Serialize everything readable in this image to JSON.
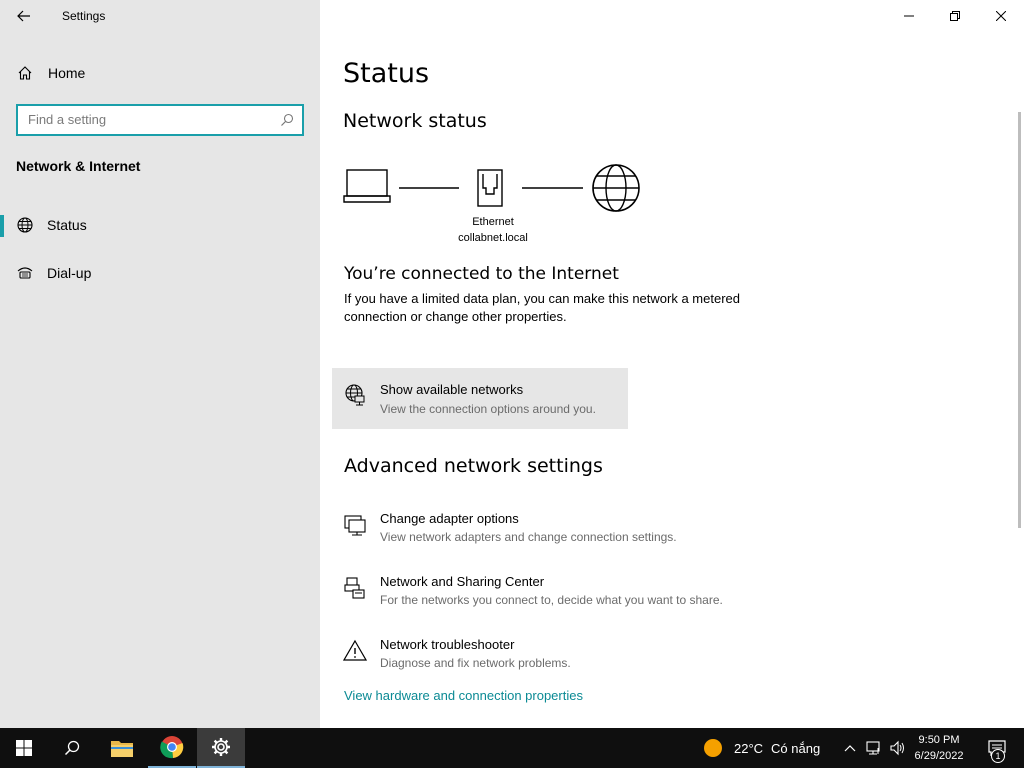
{
  "window": {
    "title": "Settings"
  },
  "sidebar": {
    "home_label": "Home",
    "search_placeholder": "Find a setting",
    "section_title": "Network & Internet",
    "items": [
      {
        "label": "Status",
        "icon": "globe-icon",
        "selected": true
      },
      {
        "label": "Dial-up",
        "icon": "dialup-icon",
        "selected": false
      }
    ]
  },
  "main": {
    "page_title": "Status",
    "network_status_title": "Network status",
    "diagram": {
      "adapter_name": "Ethernet",
      "network_name": "collabnet.local"
    },
    "connected_title": "You’re connected to the Internet",
    "connected_desc": "If you have a limited data plan, you can make this network a metered connection or change other properties.",
    "show_networks": {
      "title": "Show available networks",
      "desc": "View the connection options around you."
    },
    "advanced_title": "Advanced network settings",
    "advanced_items": [
      {
        "title": "Change adapter options",
        "desc": "View network adapters and change connection settings.",
        "icon": "adapter-icon"
      },
      {
        "title": "Network and Sharing Center",
        "desc": "For the networks you connect to, decide what you want to share.",
        "icon": "sharing-center-icon"
      },
      {
        "title": "Network troubleshooter",
        "desc": "Diagnose and fix network problems.",
        "icon": "warning-icon"
      }
    ],
    "hardware_link": "View hardware and connection properties"
  },
  "taskbar": {
    "weather_temp": "22°C",
    "weather_desc": "Có nắng",
    "time": "9:50 PM",
    "date": "6/29/2022",
    "notification_count": "1"
  },
  "colors": {
    "accent": "#1a9faa",
    "sidebar_bg": "#e6e6e6",
    "link": "#0b8a94",
    "taskbar_bg": "#0f0f0f"
  }
}
